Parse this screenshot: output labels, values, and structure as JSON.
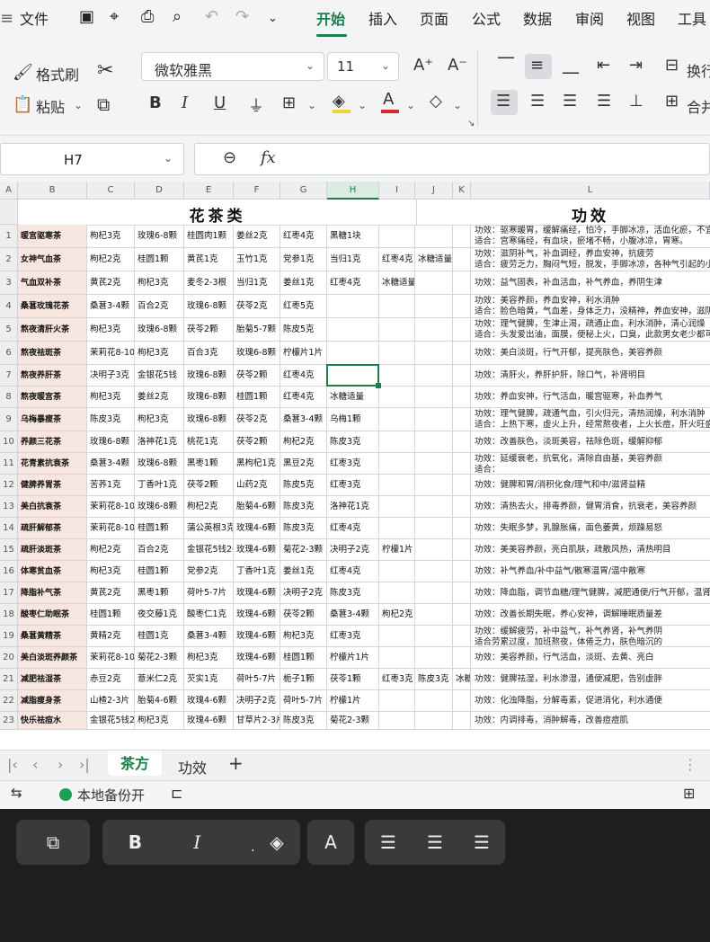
{
  "menu": {
    "file": "文件",
    "tabs": [
      "开始",
      "插入",
      "页面",
      "公式",
      "数据",
      "审阅",
      "视图",
      "工具"
    ]
  },
  "ribbon": {
    "format_painter": "格式刷",
    "paste": "粘贴",
    "font_name": "微软雅黑",
    "font_size": "11",
    "wrap": "换行",
    "merge": "合并"
  },
  "formula_bar": {
    "name_box": "H7",
    "fx": "fx"
  },
  "columns": [
    "A",
    "B",
    "C",
    "D",
    "E",
    "F",
    "G",
    "H",
    "I",
    "J",
    "K",
    "L"
  ],
  "sheet": {
    "title_left": "花茶类",
    "title_right": "功效",
    "rows": [
      {
        "n": "1",
        "name": "暖宫驱寒茶",
        "c": "枸杞3克",
        "d": "玫瑰6-8颗",
        "e": "桂圆肉1颗",
        "f": "姜丝2克",
        "g": "红枣4克",
        "h": "黑糖1块",
        "i": "",
        "j": "",
        "l1": "功效：驱寒暖胃，缓解痛经，怕冷，手脚冰凉，活血化瘀，不宜堵",
        "l2": "适合：宫寒痛经，有血块，瘀堵不畅，小腹冰凉，胃寒。"
      },
      {
        "n": "2",
        "name": "女神气血茶",
        "c": "枸杞2克",
        "d": "桂圆1颗",
        "e": "黄芪1克",
        "f": "玉竹1克",
        "g": "党参1克",
        "h": "当归1克",
        "i": "红枣4克",
        "j": "冰糖适量",
        "l1": "功效：滋阴补气，补血调经，养血安神，抗疲劳",
        "l2": "适合：疲劳乏力，胸闷气短，脱发，手脚冰凉，各种气引起的小"
      },
      {
        "n": "3",
        "name": "气血双补茶",
        "c": "黄芪2克",
        "d": "枸杞3克",
        "e": "麦冬2-3根",
        "f": "当归1克",
        "g": "姜丝1克",
        "h": "红枣4克",
        "i": "冰糖适量",
        "j": "",
        "l1": "功效：益气固表，补血活血，补气养血，养阴生津",
        "l2": ""
      },
      {
        "n": "4",
        "name": "桑葚玫瑰花茶",
        "c": "桑葚3-4颗",
        "d": "百合2克",
        "e": "玫瑰6-8颗",
        "f": "茯苓2克",
        "g": "红枣5克",
        "h": "",
        "i": "",
        "j": "",
        "l1": "功效：美容养颜，养血安神，利水消肿",
        "l2": "适合：脸色暗黄，气血差，身体乏力，没精神，养血安神，滋阴补"
      },
      {
        "n": "5",
        "name": "熬夜清肝火茶",
        "c": "枸杞3克",
        "d": "玫瑰6-8颗",
        "e": "茯苓2颗",
        "f": "胎菊5-7颗",
        "g": "陈皮5克",
        "h": "",
        "i": "",
        "j": "",
        "l1": "功效：理气健脾，生津止渴，疏通止血，利水消肿，清心润燥",
        "l2": "适合：头发爱出油，面膜，便秘上火，口臭，此款男女老少都可以"
      },
      {
        "n": "6",
        "name": "熬夜祛斑茶",
        "c": "茉莉花8-10",
        "d": "枸杞3克",
        "e": "百合3克",
        "f": "玫瑰6-8颗",
        "g": "柠檬片1片",
        "h": "",
        "i": "",
        "j": "",
        "l1": "功效：美白淡斑，行气开郁，提亮肤色，美容养颜",
        "l2": ""
      },
      {
        "n": "7",
        "name": "熬夜养肝茶",
        "c": "决明子3克",
        "d": "金银花5钱",
        "e": "玫瑰6-8颗",
        "f": "茯苓2颗",
        "g": "红枣4克",
        "h": "",
        "i": "",
        "j": "",
        "l1": "功效：清肝火，养肝护肝，除口气，补肾明目",
        "l2": ""
      },
      {
        "n": "8",
        "name": "熬夜暖宫茶",
        "c": "枸杞3克",
        "d": "姜丝2克",
        "e": "玫瑰6-8颗",
        "f": "桂圆1颗",
        "g": "红枣4克",
        "h": "冰糖适量",
        "i": "",
        "j": "",
        "l1": "功效：养血安神，行气活血，暖宫驱寒，补血养气",
        "l2": ""
      },
      {
        "n": "9",
        "name": "乌梅暴瘦茶",
        "c": "陈皮3克",
        "d": "枸杞3克",
        "e": "玫瑰6-8颗",
        "f": "茯苓2克",
        "g": "桑葚3-4颗",
        "h": "乌梅1颗",
        "i": "",
        "j": "",
        "l1": "功效：理气健脾，疏通气血，引火归元，清热润燥，利水消肿",
        "l2": "适合：上热下寒，虚火上升，经常熬夜者，上火长痘，肝火旺盛，"
      },
      {
        "n": "10",
        "name": "养颜三花茶",
        "c": "玫瑰6-8颗",
        "d": "洛神花1克",
        "e": "桃花1克",
        "f": "茯苓2颗",
        "g": "枸杞2克",
        "h": "陈皮3克",
        "i": "",
        "j": "",
        "l1": "功效：改善肤色，淡斑美容，祛除色斑，缓解抑郁",
        "l2": ""
      },
      {
        "n": "11",
        "name": "花青素抗衰茶",
        "c": "桑葚3-4颗",
        "d": "玫瑰6-8颗",
        "e": "黑枣1颗",
        "f": "黑枸杞1克",
        "g": "黑豆2克",
        "h": "红枣3克",
        "i": "",
        "j": "",
        "l1": "功效：延缓衰老，抗氧化，清除自由基，美容养颜",
        "l2": "适合："
      },
      {
        "n": "12",
        "name": "健脾养胃茶",
        "c": "苦荞1克",
        "d": "丁香叶1克",
        "e": "茯苓2颗",
        "f": "山药2克",
        "g": "陈皮5克",
        "h": "红枣3克",
        "i": "",
        "j": "",
        "l1": "功效：健脾和胃/消积化食/理气和中/滋肾益精",
        "l2": ""
      },
      {
        "n": "13",
        "name": "美白抗衰茶",
        "c": "茉莉花8-10",
        "d": "玫瑰6-8颗",
        "e": "枸杞2克",
        "f": "胎菊4-6颗",
        "g": "陈皮3克",
        "h": "洛神花1克",
        "i": "",
        "j": "",
        "l1": "功效：清热去火，排毒养颜，健胃消食，抗衰老，美容养颜",
        "l2": ""
      },
      {
        "n": "14",
        "name": "疏肝解郁茶",
        "c": "茉莉花8-10",
        "d": "桂圆1颗",
        "e": "蒲公英根3克",
        "f": "玫瑰4-6颗",
        "g": "陈皮3克",
        "h": "红枣4克",
        "i": "",
        "j": "",
        "l1": "功效：失眠多梦，乳腺胀痛，面色萎黄，烦躁易怒",
        "l2": ""
      },
      {
        "n": "15",
        "name": "疏肝淡斑茶",
        "c": "枸杞2克",
        "d": "百合2克",
        "e": "金银花5钱20",
        "f": "玫瑰4-6颗",
        "g": "菊花2-3颗",
        "h": "决明子2克",
        "i": "柠檬1片",
        "j": "",
        "l1": "功效：美美容养颜，亮白肌肤，疏散风热，清热明目",
        "l2": ""
      },
      {
        "n": "16",
        "name": "体寒贫血茶",
        "c": "枸杞3克",
        "d": "桂圆1颗",
        "e": "党参2克",
        "f": "丁香叶1克",
        "g": "姜丝1克",
        "h": "红枣4克",
        "i": "",
        "j": "",
        "l1": "功效：补气养血/补中益气/散寒温胃/温中散寒",
        "l2": ""
      },
      {
        "n": "17",
        "name": "降脂补气茶",
        "c": "黄芪2克",
        "d": "黑枣1颗",
        "e": "荷叶5-7片",
        "f": "玫瑰4-6颗",
        "g": "决明子2克",
        "h": "陈皮3克",
        "i": "",
        "j": "",
        "l1": "功效：降血脂，调节血糖/理气健脾，减肥通便/行气开郁，温肾健脾",
        "l2": ""
      },
      {
        "n": "18",
        "name": "酸枣仁助眠茶",
        "c": "桂圆1颗",
        "d": "夜交藤1克",
        "e": "酸枣仁1克",
        "f": "玫瑰4-6颗",
        "g": "茯苓2颗",
        "h": "桑葚3-4颗",
        "i": "枸杞2克",
        "j": "",
        "l1": "功效：改善长期失眠，养心安神，调解睡眠质量差",
        "l2": ""
      },
      {
        "n": "19",
        "name": "桑葚黄精茶",
        "c": "黄精2克",
        "d": "桂圆1克",
        "e": "桑葚3-4颗",
        "f": "玫瑰4-6颗",
        "g": "枸杞3克",
        "h": "红枣3克",
        "i": "",
        "j": "",
        "l1": "功效：缓解疲劳，补中益气，补气养肾，补气养阴",
        "l2": "适合劳累过度，加班熬夜，体倦乏力，肤色暗沉的"
      },
      {
        "n": "20",
        "name": "美白淡斑养颜茶",
        "c": "茉莉花8-10",
        "d": "菊花2-3颗",
        "e": "枸杞3克",
        "f": "玫瑰4-6颗",
        "g": "桂圆1颗",
        "h": "柠檬片1片",
        "i": "",
        "j": "",
        "l1": "功效：美容养颜，行气活血，淡斑、去黄、亮白",
        "l2": ""
      },
      {
        "n": "21",
        "name": "减肥祛湿茶",
        "c": "赤豆2克",
        "d": "薏米仁2克",
        "e": "芡实1克",
        "f": "荷叶5-7片",
        "g": "栀子1颗",
        "h": "茯苓1颗",
        "i": "红枣3克",
        "j": "陈皮3克",
        "l1": "功效：健脾祛湿，利水渗湿，通便减肥，告别虚胖",
        "l2": ""
      },
      {
        "n": "22",
        "name": "减脂瘦身茶",
        "c": "山楂2-3片",
        "d": "胎菊4-6颗",
        "e": "玫瑰4-6颗",
        "f": "决明子2克",
        "g": "荷叶5-7片",
        "h": "柠檬1片",
        "i": "",
        "j": "",
        "l1": "功效：化浊降脂，分解毒素，促进消化，利水通便",
        "l2": ""
      },
      {
        "n": "23",
        "name": "快乐祛痘水",
        "c": "金银花5钱2",
        "d": "枸杞3克",
        "e": "玫瑰4-6颗",
        "f": "甘草片2-3片",
        "g": "陈皮3克",
        "h": "菊花2-3颗",
        "i": "",
        "j": "",
        "l1": "功效：内调排毒，消肿解毒，改善痘痘肌",
        "l2": ""
      }
    ],
    "extra_k21": "冰糖"
  },
  "sheet_tabs": [
    "茶方",
    "功效"
  ],
  "status": {
    "backup": "本地备份开"
  },
  "floating_toolbar": [
    "paste-format",
    "bold",
    "italic",
    "underline",
    "fill-color",
    "font-color",
    "align-left",
    "align-center",
    "align-right"
  ],
  "colors": {
    "accent": "#1a7f4b",
    "name_fill": "#f7e6e0"
  }
}
